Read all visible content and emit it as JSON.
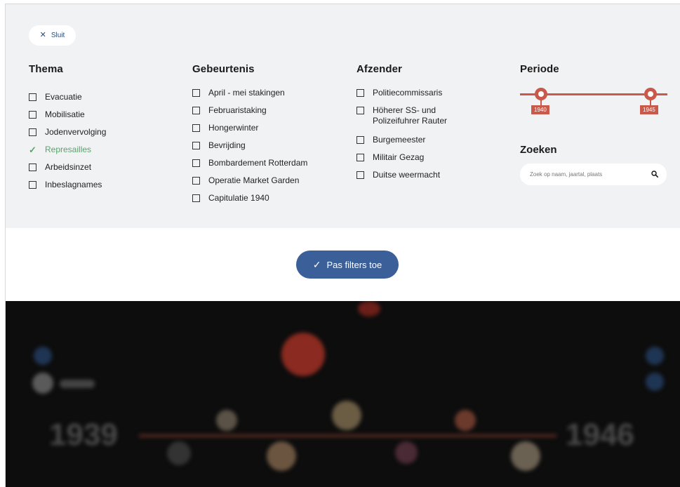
{
  "close_button": {
    "label": "Sluit"
  },
  "thema": {
    "title": "Thema",
    "items": [
      {
        "label": "Evacuatie",
        "checked": false
      },
      {
        "label": "Mobilisatie",
        "checked": false
      },
      {
        "label": "Jodenvervolging",
        "checked": false
      },
      {
        "label": "Represailles",
        "checked": true
      },
      {
        "label": "Arbeidsinzet",
        "checked": false
      },
      {
        "label": "Inbeslagnames",
        "checked": false
      }
    ]
  },
  "gebeurtenis": {
    "title": "Gebeurtenis",
    "items": [
      {
        "label": "April - mei stakingen"
      },
      {
        "label": "Februaristaking"
      },
      {
        "label": "Hongerwinter"
      },
      {
        "label": "Bevrijding"
      },
      {
        "label": "Bombardement Rotterdam"
      },
      {
        "label": "Operatie Market Garden"
      },
      {
        "label": "Capitulatie 1940"
      }
    ]
  },
  "afzender": {
    "title": "Afzender",
    "items": [
      {
        "label": "Politiecommissaris"
      },
      {
        "label": "Höherer SS- und Polizeifuhrer Rauter"
      },
      {
        "label": "Burgemeester"
      },
      {
        "label": "Militair Gezag"
      },
      {
        "label": "Duitse weermacht"
      }
    ]
  },
  "periode": {
    "title": "Periode",
    "start_label": "1940",
    "end_label": "1945"
  },
  "zoeken": {
    "title": "Zoeken",
    "placeholder": "Zoek op naam, jaartal, plaats"
  },
  "apply_button": {
    "label": "Pas filters toe"
  },
  "background_timeline": {
    "start_year": "1939",
    "end_year": "1946"
  },
  "colors": {
    "panel_bg": "#f1f2f4",
    "accent_red": "#c9594a",
    "checked_green": "#5aa36b",
    "apply_blue": "#3a5f99",
    "dark_bg": "#0d0d0d"
  }
}
